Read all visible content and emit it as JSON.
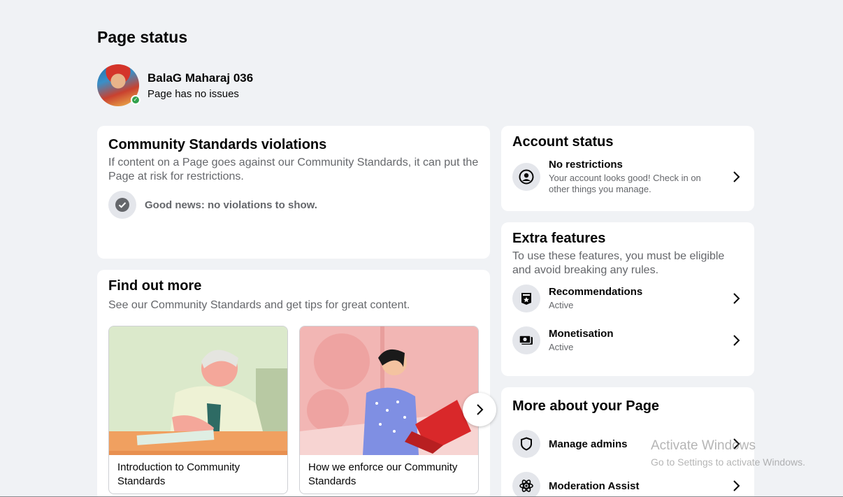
{
  "page": {
    "title": "Page status"
  },
  "profile": {
    "name": "BalaG Maharaj 036",
    "status": "Page has no issues"
  },
  "violations": {
    "title": "Community Standards violations",
    "description": "If content on a Page goes against our Community Standards, it can put the Page at risk for restrictions.",
    "good_news": "Good news: no violations to show."
  },
  "find_out_more": {
    "title": "Find out more",
    "description": "See our Community Standards and get tips for great content.",
    "cards": [
      {
        "caption": "Introduction to Community Standards"
      },
      {
        "caption": "How we enforce our Community Standards"
      }
    ]
  },
  "account_status": {
    "title": "Account status",
    "item": {
      "title": "No restrictions",
      "subtitle": "Your account looks good! Check in on other things you manage."
    }
  },
  "extra_features": {
    "title": "Extra features",
    "description": "To use these features, you must be eligible and avoid breaking any rules.",
    "items": [
      {
        "title": "Recommendations",
        "status": "Active"
      },
      {
        "title": "Monetisation",
        "status": "Active"
      }
    ]
  },
  "more_about": {
    "title": "More about your Page",
    "items": [
      {
        "title": "Manage admins"
      },
      {
        "title": "Moderation Assist"
      }
    ]
  },
  "watermark": {
    "line1": "Activate Windows",
    "line2": "Go to Settings to activate Windows."
  },
  "colors": {
    "background": "#f0f2f5",
    "card": "#ffffff",
    "secondary_text": "#65676b",
    "icon_bg": "#e4e6eb",
    "success": "#31a24c",
    "accent_red": "#e02020"
  }
}
